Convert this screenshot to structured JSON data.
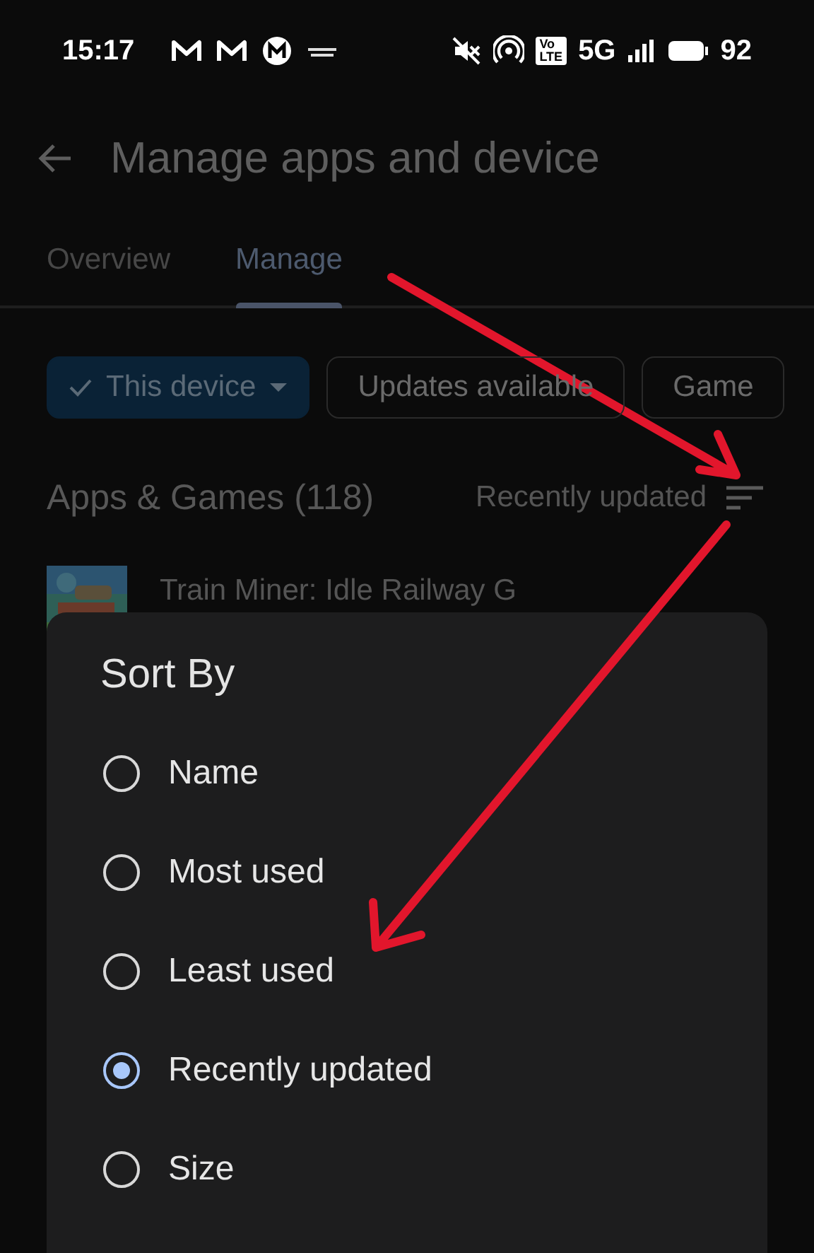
{
  "status_bar": {
    "time": "15:17",
    "volte": [
      "Vo",
      "LTE"
    ],
    "network": "5G",
    "battery": "92"
  },
  "header": {
    "title": "Manage apps and device"
  },
  "tabs": [
    {
      "label": "Overview",
      "selected": false
    },
    {
      "label": "Manage",
      "selected": true
    }
  ],
  "filters": [
    {
      "label": "This device",
      "selected": true
    },
    {
      "label": "Updates available",
      "selected": false
    },
    {
      "label": "Game",
      "selected": false
    }
  ],
  "section": {
    "title": "Apps & Games (118)",
    "sort_label": "Recently updated"
  },
  "apps": [
    {
      "name": "Train Miner: Idle Railway G"
    }
  ],
  "sort_sheet": {
    "title": "Sort By",
    "options": [
      {
        "label": "Name",
        "selected": false
      },
      {
        "label": "Most used",
        "selected": false
      },
      {
        "label": "Least used",
        "selected": false
      },
      {
        "label": "Recently updated",
        "selected": true
      },
      {
        "label": "Size",
        "selected": false
      }
    ]
  }
}
